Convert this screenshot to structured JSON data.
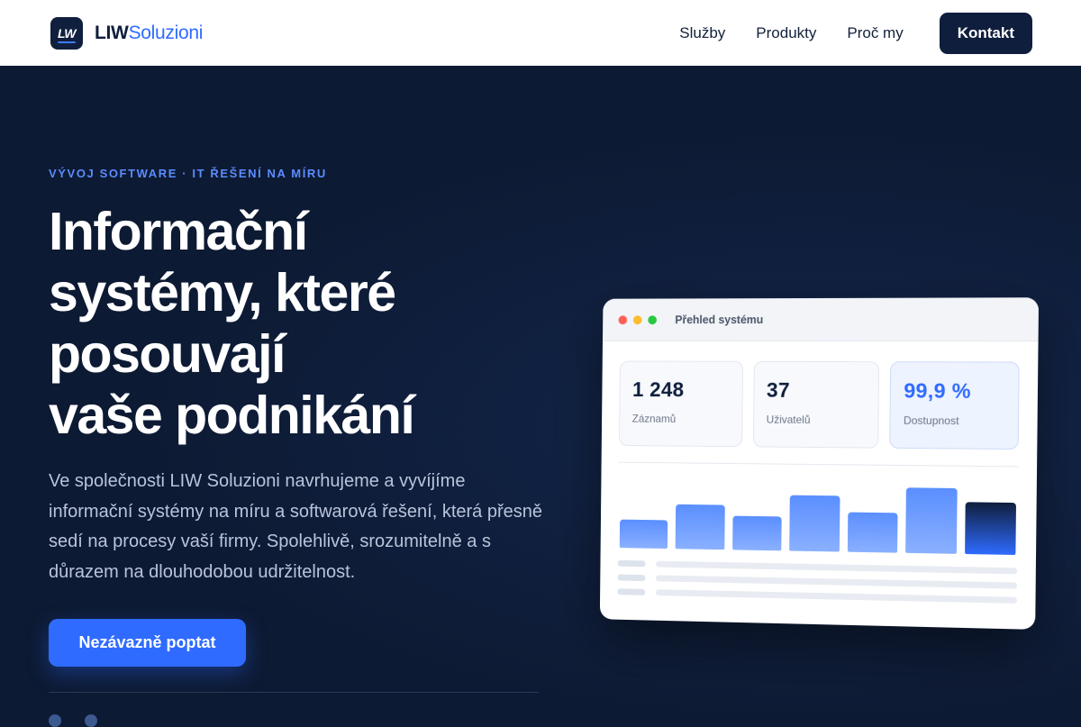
{
  "header": {
    "logo_text": "LW",
    "brand_primary": "LIW",
    "brand_accent": "Soluzioni",
    "nav": [
      {
        "label": "Služby"
      },
      {
        "label": "Produkty"
      },
      {
        "label": "Proč my"
      }
    ],
    "cta_label": "Kontakt"
  },
  "hero": {
    "eyebrow": "VÝVOJ SOFTWARE · IT ŘEŠENÍ NA MÍRU",
    "headline_lines": [
      "Informační",
      "systémy, které",
      "posouvají",
      "vaše podnikání"
    ],
    "lead": "Ve společnosti LIW Soluzioni navrhujeme a vyvíjíme informační systémy na míru a softwarová řešení, která přesně sedí na procesy vaší firmy. Spolehlivě, srozumitelně a s důrazem na dlouhodobou udržitelnost.",
    "cta_label": "Nezávazně poptat"
  },
  "dashboard": {
    "title": "Přehled systému",
    "stats": [
      {
        "value": "1 248",
        "label": "Záznamů"
      },
      {
        "value": "37",
        "label": "Uživatelů"
      },
      {
        "value": "99,9 %",
        "label": "Dostupnost"
      }
    ],
    "bar_levels": [
      0.42,
      0.66,
      0.5,
      0.82,
      0.58,
      0.95,
      0.75
    ]
  },
  "colors": {
    "brand": "#0f1e3c",
    "accent": "#2f6bff",
    "hero_bg": "#0d1a33"
  }
}
